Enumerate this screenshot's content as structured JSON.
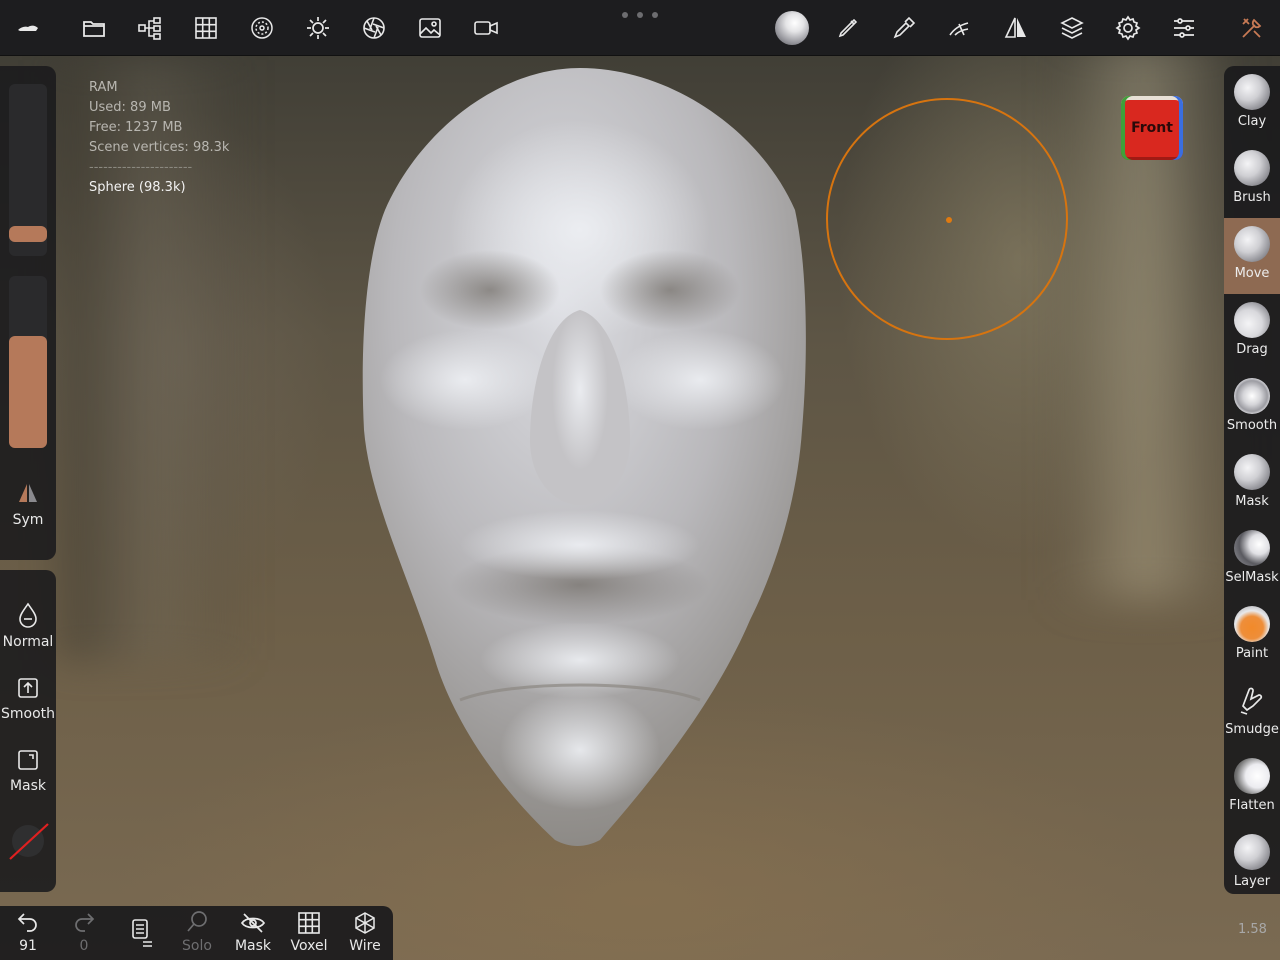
{
  "toolbar": {
    "icons": [
      "logo-icon",
      "folder-icon",
      "scene-tree-icon",
      "topology-grid-icon",
      "material-sphere-icon",
      "light-sun-icon",
      "camera-aperture-icon",
      "background-image-icon",
      "video-camera-icon",
      "matcap-ball-icon",
      "brush-pen-icon",
      "picker-icon",
      "stroke-icon",
      "symmetry-icon",
      "layers-icon",
      "settings-gear-icon",
      "sliders-icon",
      "tools-icon"
    ]
  },
  "info": {
    "ram_label": "RAM",
    "used": "Used: 89 MB",
    "free": "Free: 1237 MB",
    "vertices": "Scene vertices: 98.3k",
    "separator": "----------------------",
    "object": "Sphere (98.3k)"
  },
  "left_panel": {
    "sym_label": "Sym",
    "radius_value": 0.08,
    "intensity_value": 0.65,
    "modes": [
      {
        "label": "Normal"
      },
      {
        "label": "Smooth"
      },
      {
        "label": "Mask"
      }
    ]
  },
  "bottom_bar": {
    "undo_count": "91",
    "redo_count": "0",
    "solo_label": "Solo",
    "mask_label": "Mask",
    "voxel_label": "Voxel",
    "wire_label": "Wire"
  },
  "brushes": [
    {
      "label": "Clay",
      "active": false
    },
    {
      "label": "Brush",
      "active": false
    },
    {
      "label": "Move",
      "active": true
    },
    {
      "label": "Drag",
      "active": false
    },
    {
      "label": "Smooth",
      "active": false
    },
    {
      "label": "Mask",
      "active": false
    },
    {
      "label": "SelMask",
      "active": false
    },
    {
      "label": "Paint",
      "active": false
    },
    {
      "label": "Smudge",
      "active": false
    },
    {
      "label": "Flatten",
      "active": false
    },
    {
      "label": "Layer",
      "active": false
    }
  ],
  "view_cube": {
    "label": "Front"
  },
  "zoom": "1.58",
  "colors": {
    "accent": "#b5795a",
    "brush_cursor": "#d7740f",
    "active_brush_bg": "#8e6a52"
  }
}
